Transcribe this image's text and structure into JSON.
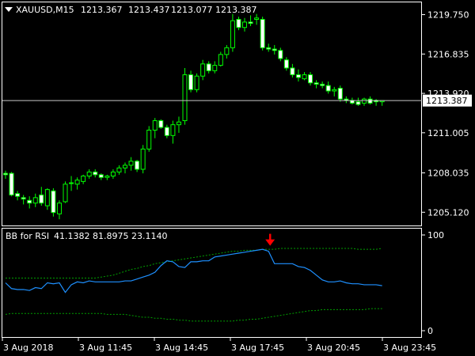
{
  "header": {
    "symbol_label": "XAUUSD,M15",
    "ohlc": [
      "1213.367",
      "1213.437",
      "1213.077",
      "1213.387"
    ]
  },
  "indicator": {
    "title": "BB for RSI",
    "values": [
      "41.1382",
      "81.8975",
      "23.1140"
    ]
  },
  "colors": {
    "background": "#000000",
    "bull": "#00ff00",
    "bear": "#ffffff",
    "rsi_line": "#1e90ff",
    "bands": "#00a000",
    "signal_arrow": "#ff0000",
    "frame": "#ffffff"
  },
  "price_axis": {
    "ticks": [
      "1219.750",
      "1216.835",
      "1213.920",
      "1211.005",
      "1208.035",
      "1205.120"
    ],
    "current_price": "1213.387"
  },
  "indicator_axis": {
    "ticks": [
      "100",
      "0"
    ]
  },
  "time_axis": {
    "ticks": [
      "3 Aug 2018",
      "3 Aug 11:45",
      "3 Aug 14:45",
      "3 Aug 17:45",
      "3 Aug 20:45",
      "3 Aug 23:45"
    ]
  },
  "chart_data": {
    "type": "candlestick",
    "price_range": [
      1204.2,
      1220.6
    ],
    "candles": [
      [
        1208.0,
        1208.2,
        1207.6,
        1207.9
      ],
      [
        1208.0,
        1208.1,
        1206.3,
        1206.4
      ],
      [
        1206.5,
        1206.7,
        1206.0,
        1206.3
      ],
      [
        1206.2,
        1206.4,
        1205.7,
        1206.1
      ],
      [
        1206.0,
        1206.3,
        1205.4,
        1205.8
      ],
      [
        1205.8,
        1206.5,
        1205.5,
        1206.2
      ],
      [
        1206.4,
        1207.0,
        1205.6,
        1205.8
      ],
      [
        1205.6,
        1206.9,
        1205.3,
        1206.8
      ],
      [
        1206.7,
        1206.9,
        1204.8,
        1205.1
      ],
      [
        1205.0,
        1206.0,
        1204.6,
        1205.8
      ],
      [
        1205.9,
        1207.4,
        1205.8,
        1207.2
      ],
      [
        1207.3,
        1207.8,
        1206.7,
        1207.3
      ],
      [
        1207.2,
        1207.7,
        1206.8,
        1207.5
      ],
      [
        1207.4,
        1207.9,
        1207.2,
        1207.8
      ],
      [
        1207.8,
        1208.3,
        1207.6,
        1208.1
      ],
      [
        1208.1,
        1208.3,
        1207.7,
        1207.9
      ],
      [
        1207.9,
        1208.0,
        1207.5,
        1207.7
      ],
      [
        1207.7,
        1207.9,
        1207.5,
        1207.8
      ],
      [
        1207.8,
        1208.3,
        1207.6,
        1208.1
      ],
      [
        1208.1,
        1208.6,
        1207.9,
        1208.4
      ],
      [
        1208.4,
        1208.8,
        1208.0,
        1208.6
      ],
      [
        1208.6,
        1209.2,
        1208.2,
        1208.9
      ],
      [
        1208.9,
        1209.0,
        1208.1,
        1208.3
      ],
      [
        1208.3,
        1210.1,
        1208.0,
        1209.8
      ],
      [
        1209.8,
        1211.5,
        1209.6,
        1211.2
      ],
      [
        1211.2,
        1212.1,
        1210.6,
        1211.9
      ],
      [
        1211.9,
        1212.0,
        1211.3,
        1211.4
      ],
      [
        1211.4,
        1211.6,
        1210.6,
        1210.8
      ],
      [
        1210.8,
        1211.9,
        1210.2,
        1211.6
      ],
      [
        1211.6,
        1212.2,
        1211.0,
        1211.8
      ],
      [
        1211.9,
        1215.8,
        1211.6,
        1215.3
      ],
      [
        1215.3,
        1215.6,
        1214.0,
        1214.2
      ],
      [
        1214.2,
        1215.4,
        1214.0,
        1215.2
      ],
      [
        1215.2,
        1216.4,
        1214.9,
        1216.1
      ],
      [
        1216.1,
        1216.3,
        1215.4,
        1215.6
      ],
      [
        1215.6,
        1216.3,
        1215.4,
        1216.0
      ],
      [
        1216.0,
        1217.0,
        1215.9,
        1216.8
      ],
      [
        1216.8,
        1217.5,
        1216.5,
        1217.3
      ],
      [
        1217.3,
        1219.8,
        1217.0,
        1219.3
      ],
      [
        1219.4,
        1219.6,
        1218.6,
        1218.8
      ],
      [
        1218.8,
        1219.5,
        1218.5,
        1219.2
      ],
      [
        1219.2,
        1219.7,
        1218.9,
        1219.1
      ],
      [
        1219.4,
        1219.8,
        1219.0,
        1219.5
      ],
      [
        1219.4,
        1219.6,
        1217.1,
        1217.3
      ],
      [
        1217.3,
        1217.6,
        1217.0,
        1217.2
      ],
      [
        1217.2,
        1217.5,
        1216.8,
        1217.1
      ],
      [
        1217.1,
        1217.3,
        1216.3,
        1216.5
      ],
      [
        1216.4,
        1216.6,
        1215.6,
        1215.8
      ],
      [
        1215.8,
        1216.1,
        1215.1,
        1215.3
      ],
      [
        1215.3,
        1215.7,
        1214.8,
        1215.1
      ],
      [
        1215.0,
        1215.5,
        1214.9,
        1215.3
      ],
      [
        1215.3,
        1215.5,
        1214.5,
        1214.7
      ],
      [
        1214.7,
        1214.9,
        1214.3,
        1214.6
      ],
      [
        1214.6,
        1214.8,
        1214.3,
        1214.5
      ],
      [
        1214.5,
        1214.8,
        1213.9,
        1214.1
      ],
      [
        1214.1,
        1214.4,
        1213.7,
        1214.2
      ],
      [
        1214.3,
        1214.5,
        1213.3,
        1213.5
      ],
      [
        1213.5,
        1213.7,
        1213.2,
        1213.4
      ],
      [
        1213.4,
        1213.6,
        1213.1,
        1213.2
      ],
      [
        1213.3,
        1213.6,
        1213.0,
        1213.1
      ],
      [
        1213.2,
        1213.6,
        1213.0,
        1213.5
      ],
      [
        1213.5,
        1213.7,
        1213.1,
        1213.2
      ],
      [
        1213.4,
        1213.5,
        1213.0,
        1213.3
      ],
      [
        1213.3,
        1213.4,
        1213.0,
        1213.387
      ]
    ],
    "rsi_range": [
      0,
      100
    ],
    "rsi": [
      50,
      44,
      43,
      43,
      42,
      45,
      44,
      50,
      49,
      50,
      40,
      48,
      51,
      50,
      52,
      51,
      51,
      51,
      51,
      51,
      52,
      52,
      54,
      56,
      58,
      61,
      68,
      73,
      72,
      67,
      66,
      72,
      72,
      73,
      73,
      77,
      78,
      79,
      80,
      81,
      82,
      83,
      84,
      85,
      83,
      70,
      70,
      70,
      70,
      67,
      66,
      63,
      58,
      53,
      51,
      51,
      52,
      50,
      49,
      49,
      48,
      48,
      48,
      47
    ],
    "upper_band": [
      55,
      55,
      55,
      55,
      55,
      55,
      55,
      55,
      55,
      55,
      55,
      55,
      55,
      55,
      55,
      55,
      56,
      57,
      58,
      60,
      62,
      64,
      65,
      67,
      68,
      70,
      71,
      72,
      73,
      74,
      75,
      76,
      77,
      78,
      79,
      80,
      81,
      82,
      83,
      83,
      84,
      84,
      84,
      85,
      85,
      85,
      86,
      86,
      86,
      86,
      86,
      86,
      86,
      86,
      86,
      86,
      86,
      86,
      86,
      85,
      85,
      85,
      85,
      86
    ],
    "lower_band": [
      17,
      18,
      18,
      18,
      18,
      18,
      18,
      18,
      18,
      18,
      18,
      18,
      18,
      18,
      18,
      18,
      18,
      17,
      17,
      17,
      17,
      16,
      15,
      14,
      14,
      13,
      13,
      12,
      12,
      11,
      11,
      10,
      10,
      10,
      10,
      10,
      10,
      10,
      10,
      11,
      11,
      12,
      12,
      13,
      14,
      15,
      16,
      17,
      18,
      19,
      20,
      21,
      21,
      22,
      22,
      22,
      22,
      22,
      22,
      22,
      22,
      23,
      23,
      23
    ],
    "signal_arrow_index": 44
  }
}
